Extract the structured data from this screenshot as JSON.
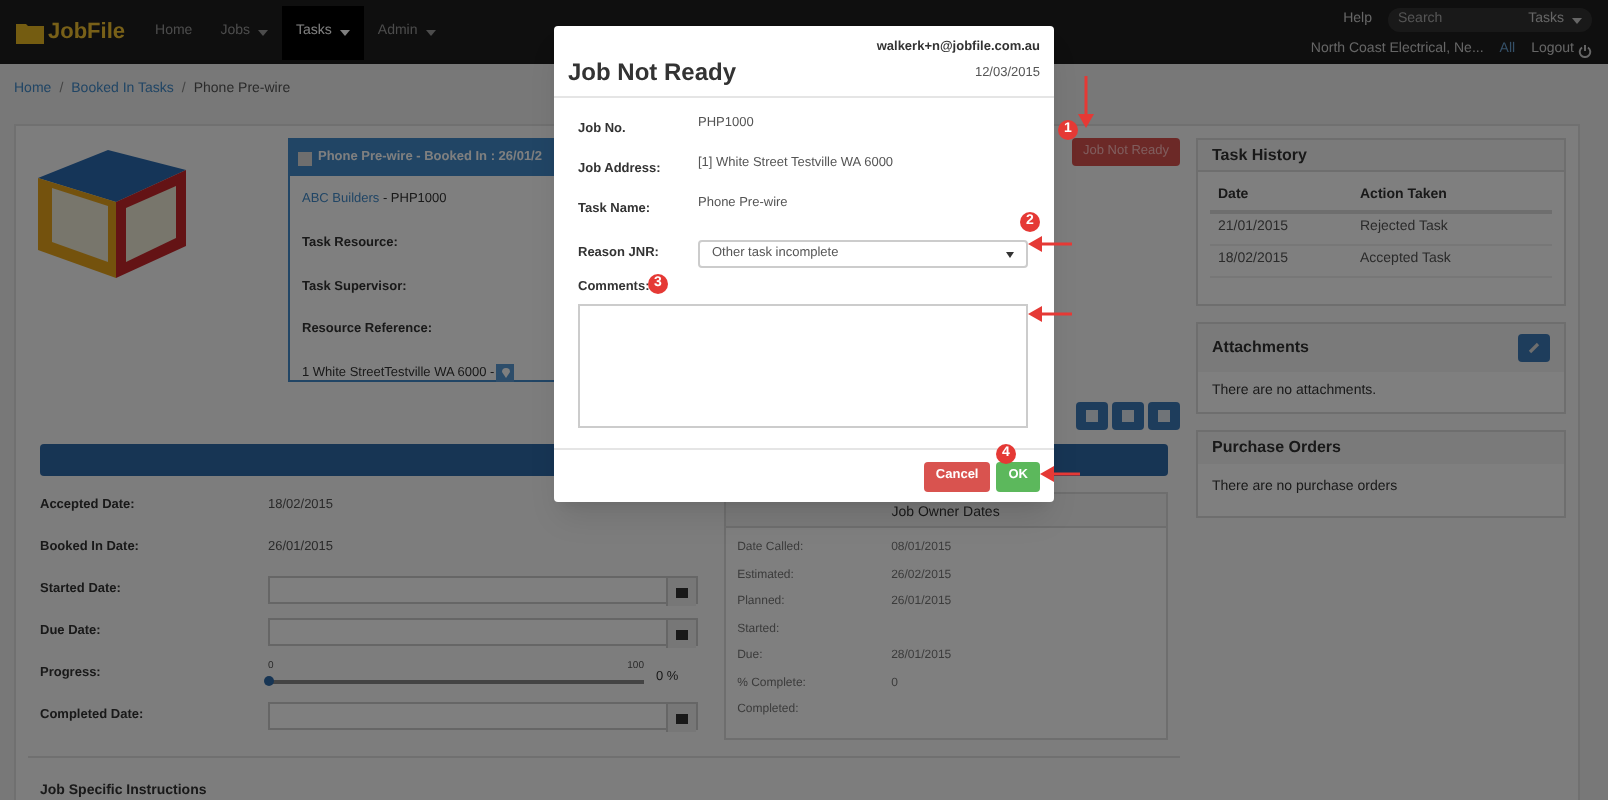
{
  "navbar": {
    "logo": "JobFile",
    "items": [
      {
        "label": "Home",
        "dropdown": false,
        "selected": false
      },
      {
        "label": "Jobs",
        "dropdown": true,
        "selected": false
      },
      {
        "label": "Tasks",
        "dropdown": true,
        "selected": true
      },
      {
        "label": "Admin",
        "dropdown": true,
        "selected": false
      }
    ],
    "help": "Help",
    "search": {
      "placeholder": "Search",
      "scope": "Tasks"
    },
    "company": "North Coast Electrical, Ne...",
    "all": "All",
    "logout": "Logout"
  },
  "breadcrumb": [
    "Home",
    "Booked In Tasks",
    "Phone Pre-wire"
  ],
  "breadcrumb_separator": "/",
  "task_card": {
    "title": "Phone Pre-wire - Booked In : 26/01/2",
    "client_link": "ABC Builders",
    "job_no": " - PHP1000",
    "labels": [
      "Task Resource:",
      "Task Supervisor:",
      "Resource Reference:"
    ],
    "address": "1 White StreetTestville WA 6000 - "
  },
  "job_not_ready_button": "Job Not Ready",
  "dates": [
    {
      "label": "Accepted Date:",
      "kind": "text",
      "value": "18/02/2015"
    },
    {
      "label": "Booked In Date:",
      "kind": "text",
      "value": "26/01/2015"
    },
    {
      "label": "Started Date:",
      "kind": "date"
    },
    {
      "label": "Due Date:",
      "kind": "date"
    },
    {
      "label": "Progress:",
      "kind": "slider",
      "level": 0,
      "min": "0",
      "max": "100",
      "reading": "0 %"
    },
    {
      "label": "Completed Date:",
      "kind": "date"
    }
  ],
  "owner_dates": {
    "title": "Job Owner Dates",
    "rows": [
      {
        "label": "Date Called:",
        "value": "08/01/2015"
      },
      {
        "label": "Estimated:",
        "value": "26/02/2015"
      },
      {
        "label": "Planned:",
        "value": "26/01/2015"
      },
      {
        "label": "Started:"
      },
      {
        "label": "Due:",
        "value": "28/01/2015"
      },
      {
        "label": "% Complete:",
        "value": "0"
      },
      {
        "label": "Completed:"
      }
    ]
  },
  "instructions_heading": "Job Specific Instructions",
  "task_history": {
    "title": "Task History",
    "columns": [
      "Date",
      "Action Taken"
    ],
    "rows": [
      [
        "21/01/2015",
        "Rejected Task"
      ],
      [
        "18/02/2015",
        "Accepted Task"
      ]
    ]
  },
  "attachments": {
    "title": "Attachments",
    "empty": "There are no attachments."
  },
  "purchase_orders": {
    "title": "Purchase Orders",
    "empty": "There are no purchase orders"
  },
  "modal": {
    "title": "Job Not Ready",
    "email": "walkerk+n@jobfile.com.au",
    "date": "12/03/2015",
    "fields": [
      {
        "label": "Job No.",
        "value": "PHP1000"
      },
      {
        "label": "Job Address:",
        "value": "[1] White Street Testville WA 6000"
      },
      {
        "label": "Task Name:",
        "value": "Phone Pre-wire"
      }
    ],
    "reason_label": "Reason JNR:",
    "reason_value": "Other task incomplete",
    "comments_label": "Comments:",
    "cancel": "Cancel",
    "ok": "OK"
  },
  "callouts": [
    "1",
    "2",
    "3",
    "4"
  ]
}
